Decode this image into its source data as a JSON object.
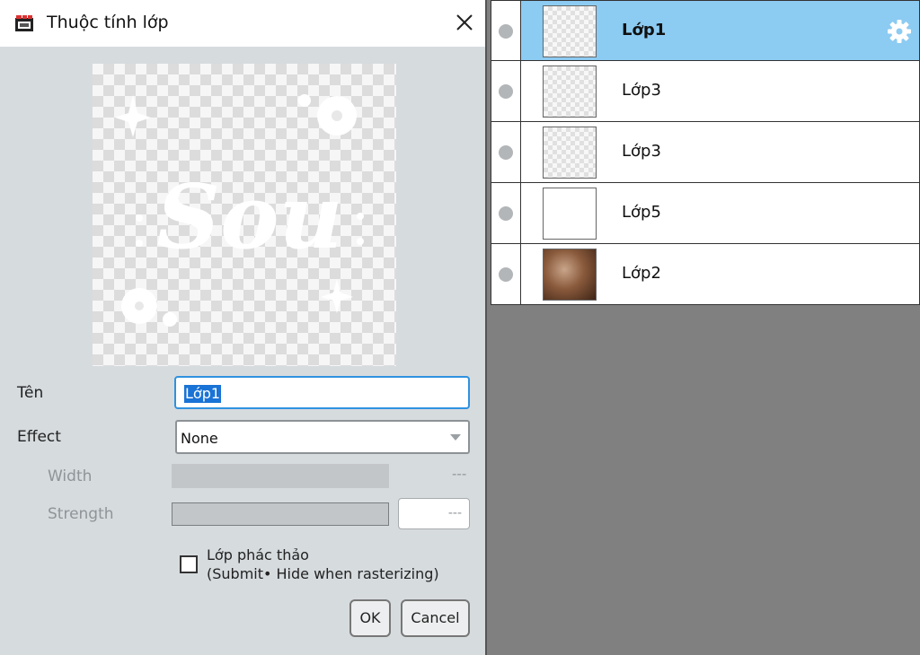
{
  "dialog": {
    "title": "Thuộc tính lớp",
    "preview_text": "Sou",
    "fields": {
      "name_label": "Tên",
      "name_value": "Lớp1",
      "effect_label": "Effect",
      "effect_value": "None",
      "width_label": "Width",
      "width_value": "---",
      "strength_label": "Strength",
      "strength_value": "---"
    },
    "checkbox": {
      "line1": "Lớp phác thảo",
      "line2": "(Submit• Hide when rasterizing)",
      "checked": false
    },
    "buttons": {
      "ok": "OK",
      "cancel": "Cancel"
    }
  },
  "layers": [
    {
      "name": "Lớp1",
      "active": true,
      "thumb": "checker"
    },
    {
      "name": "Lớp3",
      "active": false,
      "thumb": "checker"
    },
    {
      "name": "Lớp3",
      "active": false,
      "thumb": "checker"
    },
    {
      "name": "Lớp5",
      "active": false,
      "thumb": "white"
    },
    {
      "name": "Lớp2",
      "active": false,
      "thumb": "photo"
    }
  ],
  "colors": {
    "active_row": "#8ccbf2",
    "input_focus": "#2f92e0",
    "selection": "#1a73d6",
    "dialog_bg": "#d6dbde",
    "canvas_bg": "#808080"
  }
}
